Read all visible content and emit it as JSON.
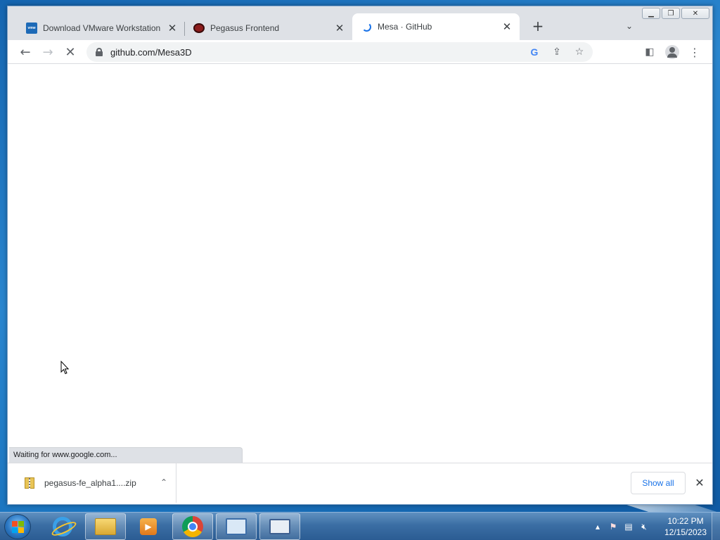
{
  "browser": {
    "tabs": [
      {
        "title": "Download VMware Workstation P",
        "favicon": "vmware-icon",
        "active": false
      },
      {
        "title": "Pegasus Frontend",
        "favicon": "pegasus-icon",
        "active": false
      },
      {
        "title": "Mesa · GitHub",
        "favicon": "loading-spinner-icon",
        "active": true
      }
    ],
    "omnibox": {
      "url": "github.com/Mesa3D"
    },
    "status_text": "Waiting for www.google.com...",
    "download": {
      "filename": "pegasus-fe_alpha1....zip"
    },
    "show_all_label": "Show all"
  },
  "taskbar": {
    "clock_time": "10:22 PM",
    "clock_date": "12/15/2023",
    "apps": [
      "internet-explorer",
      "windows-explorer",
      "media-player",
      "google-chrome",
      "control-panel",
      "on-screen-keyboard"
    ]
  },
  "colors": {
    "accent": "#1a73e8",
    "tabstrip": "#dee1e6",
    "taskbar": "#3b6ea4"
  }
}
